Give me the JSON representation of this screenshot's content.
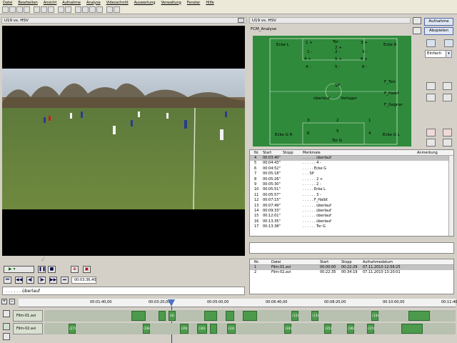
{
  "menu": [
    "Datei",
    "Bearbeiten",
    "Ansicht",
    "Aufnahme",
    "Analyse",
    "Videoschnitt",
    "Auswertung",
    "Verwaltung",
    "Fenster",
    "Hilfe"
  ],
  "toolbar_icons": [
    "new-icon",
    "open-icon",
    "save-icon",
    "print-icon",
    "cut-icon",
    "copy-icon",
    "paste-icon",
    "undo-icon",
    "redo-icon",
    "settings-icon",
    "play-icon",
    "grid-icon",
    "chart-icon",
    "list-icon",
    "help-icon"
  ],
  "video_panel": {
    "title": "U19 vs. HSV"
  },
  "analysis_panel": {
    "title": "U19 vs. HSV",
    "subtitle": "FCM_Analyse",
    "btn_aufnahme": "Aufnahme",
    "btn_abspielen": "Abspielen",
    "mode_select": "Einfach"
  },
  "pitch_labels": {
    "tor_top": "Tor",
    "ecke_l": "Ecke L",
    "ecke_r": "Ecke R",
    "l1": "1 +",
    "l2": "1 -",
    "l3": "4 +",
    "l4": "4 -",
    "m1": "2 +",
    "m2": "2 -",
    "m3": "5 +",
    "m4": "5 -",
    "r1": "3 +",
    "r2": "3 -",
    "r3": "6 +",
    "r4": "6 -",
    "sp": "SP",
    "uberlauf": "überlauf",
    "verlager": "Verlager",
    "f_torr": "F_Torr.",
    "f_halbf": "F_Halbf.",
    "f_gegner": "F_Gegner",
    "ecke_gr": "Ecke G R",
    "ecke_gl": "Ecke G L",
    "tor_g": "Tor G",
    "n3": "3",
    "n2": "2",
    "n1": "1",
    "n6": "6",
    "n5": "5",
    "n4": "4"
  },
  "events_table": {
    "headers": [
      "Nr.",
      "Start",
      "Stopp",
      "Merkmale",
      "Anmerkung"
    ],
    "rows": [
      {
        "nr": "4",
        "start": "00:03:40\"",
        "merk": ". . . . . . überlauf",
        "sel": true
      },
      {
        "nr": "5",
        "start": "00:04:43\"",
        "merk": ". . . . . . 4 -",
        "sel": false
      },
      {
        "nr": "6",
        "start": "00:04:52\"",
        "merk": ". . . . . Ecke G",
        "sel": false
      },
      {
        "nr": "7",
        "start": "00:05:18\"",
        "merk": ". . . SP",
        "sel": false
      },
      {
        "nr": "8",
        "start": "00:05:26\"",
        "merk": ". . . . . . 2 +",
        "sel": false
      },
      {
        "nr": "9",
        "start": "00:05:30\"",
        "merk": ". . . . . . 2 -",
        "sel": false
      },
      {
        "nr": "10",
        "start": "00:05:51\"",
        "merk": ". . . . . Ecke L",
        "sel": false
      },
      {
        "nr": "11",
        "start": "00:05:57\"",
        "merk": ". . . . . . 3 -",
        "sel": false
      },
      {
        "nr": "12",
        "start": "00:07:15\"",
        "merk": ". . . . . F_Halbf.",
        "sel": false
      },
      {
        "nr": "13",
        "start": "00:07:49\"",
        "merk": ". . . . . . überlauf",
        "sel": false
      },
      {
        "nr": "14",
        "start": "00:09:33\"",
        "merk": ". . . . . . überlauf",
        "sel": false
      },
      {
        "nr": "15",
        "start": "00:12:01\"",
        "merk": ". . . . . . überlauf",
        "sel": false
      },
      {
        "nr": "16",
        "start": "00:13:35\"",
        "merk": ". . . . . . überlauf",
        "sel": false
      },
      {
        "nr": "17",
        "start": "00:13:38\"",
        "merk": ". . . . . . Tor G",
        "sel": false
      }
    ]
  },
  "films_table": {
    "headers": [
      "Nr.",
      "Datei",
      "Start",
      "Stopp",
      "Aufnahmedatum"
    ],
    "rows": [
      {
        "nr": "1",
        "datei": "Film-01.avi",
        "start": "00:00:00",
        "stopp": "00:22:29",
        "datum": "07.11.2010 12:56:25",
        "sel": true
      },
      {
        "nr": "2",
        "datei": "Film-02.avi",
        "start": "00:22:35",
        "stopp": "00:34:19",
        "datum": "07.11.2010 13:20:01",
        "sel": false
      }
    ]
  },
  "player": {
    "time": "00:03:36,40",
    "label": ". . . . . . überlauf"
  },
  "timeline": {
    "ticks": [
      "00:01:40,00",
      "00:03:20,00",
      "00:05:00,00",
      "00:06:40,00",
      "00:08:20,00",
      "00:10:00,00",
      "00:11:40,00"
    ],
    "track1": "Film-01.avi",
    "track2": "Film-02.avi",
    "clips1": [
      "(4)",
      "(12)",
      "(13)",
      "(14)"
    ],
    "clips2": [
      "(27)",
      "(28)",
      "(29)",
      "(30)",
      "(33)",
      "(34)",
      "(35)",
      "(36)",
      "(37)"
    ]
  },
  "colors": {
    "pitch": "#2f8a3b",
    "line": "#ffffff",
    "clip": "#4c9a4c"
  }
}
